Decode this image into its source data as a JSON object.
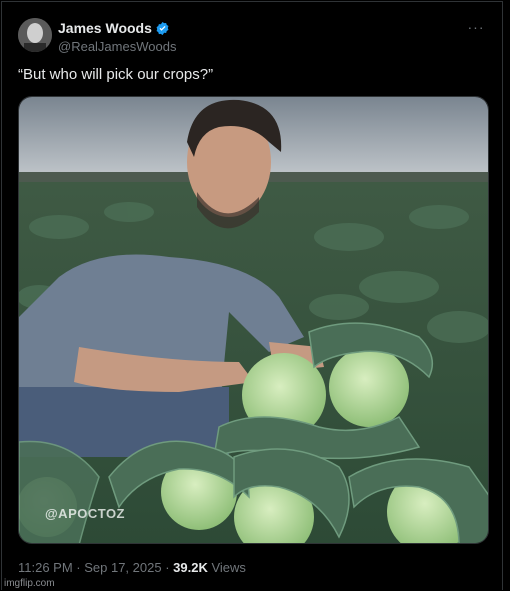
{
  "author": {
    "display_name": "James Woods",
    "handle": "@RealJamesWoods"
  },
  "tweet": {
    "text": "“But who will pick our crops?”",
    "timestamp": "11:26 PM · Sep 17, 2025 ·",
    "views_count": "39.2K",
    "views_label": "Views"
  },
  "media": {
    "watermark": "@APOCTOZ"
  },
  "credit": "imgflip.com",
  "icons": {
    "avatar": "avatar",
    "verified": "verified-badge-icon",
    "more": "more-options-icon"
  },
  "colors": {
    "background": "#000000",
    "verified_blue": "#1d9bf0",
    "muted": "#71767b"
  }
}
